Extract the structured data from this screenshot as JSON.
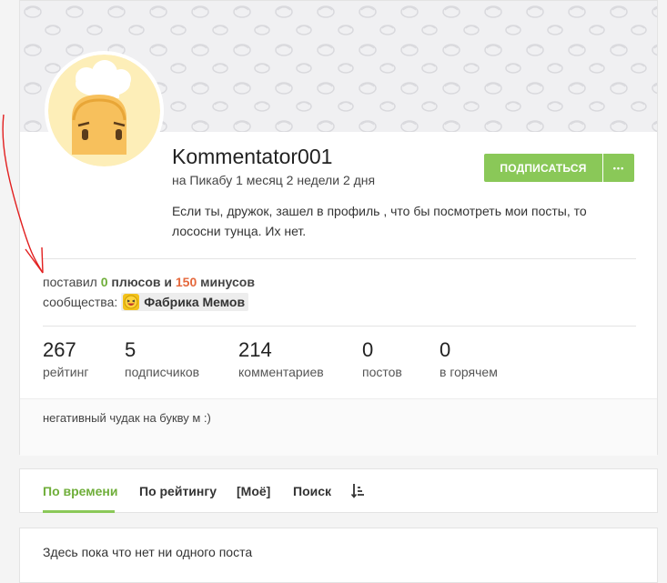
{
  "profile": {
    "username": "Kommentator001",
    "since": "на Пикабу 1 месяц 2 недели 2 дня",
    "bio": "Если ты, дружок, зашел в профиль , что бы посмотреть мои посты, то лососни тунца. Их нет.",
    "subscribe_label": "ПОДПИСАТЬСЯ",
    "more_label": "•••",
    "votes": {
      "prefix": "поставил",
      "plus_count": "0",
      "plus_word": "плюсов и",
      "minus_count": "150",
      "minus_word": "минусов"
    },
    "communities_label": "сообщества:",
    "community_name": "Фабрика Мемов",
    "stats": [
      {
        "value": "267",
        "label": "рейтинг"
      },
      {
        "value": "5",
        "label": "подписчиков"
      },
      {
        "value": "214",
        "label": "комментариев"
      },
      {
        "value": "0",
        "label": "постов"
      },
      {
        "value": "0",
        "label": "в горячем"
      }
    ],
    "about": "негативный чудак на букву м :)"
  },
  "tabs": {
    "items": [
      "По времени",
      "По рейтингу",
      "[Моё]",
      "Поиск"
    ],
    "active_index": 0
  },
  "posts": {
    "empty_message": "Здесь пока что нет ни одного поста"
  },
  "colors": {
    "accent": "#8ac858",
    "plus": "#6fae3a",
    "minus": "#e5683c",
    "annotation": "#e21f1f"
  },
  "icons": {
    "more": "ellipsis-icon",
    "sort": "sort-icon",
    "community": "laughing-emoji-icon",
    "annotation": "red-arrow-annotation"
  }
}
